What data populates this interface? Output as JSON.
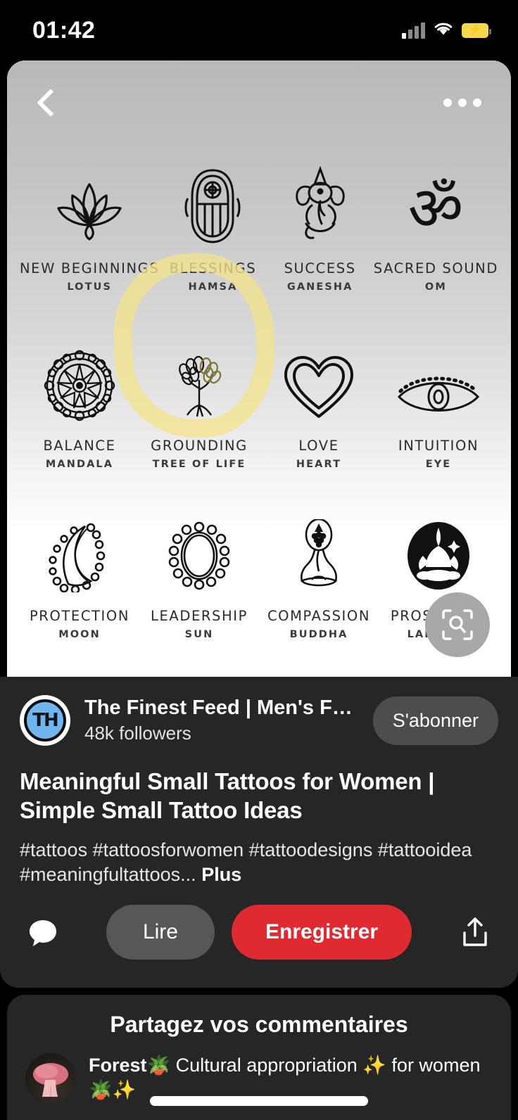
{
  "status_bar": {
    "time": "01:42",
    "signal_icon": "cellular-signal-icon",
    "wifi_icon": "wifi-icon",
    "battery_icon": "battery-charging-icon",
    "battery_color": "#f5d84b"
  },
  "pin_image": {
    "back_icon": "back-chevron-icon",
    "more_icon": "more-options-icon",
    "lens_icon": "visual-search-icon",
    "highlight_color": "#f3e28c",
    "symbols": [
      {
        "title": "NEW BEGINNINGS",
        "subtitle": "LOTUS",
        "art": "lotus"
      },
      {
        "title": "BLESSINGS",
        "subtitle": "HAMSA",
        "art": "hamsa"
      },
      {
        "title": "SUCCESS",
        "subtitle": "GANESHA",
        "art": "ganesha"
      },
      {
        "title": "SACRED SOUND",
        "subtitle": "OM",
        "art": "om"
      },
      {
        "title": "BALANCE",
        "subtitle": "MANDALA",
        "art": "mandala"
      },
      {
        "title": "GROUNDING",
        "subtitle": "TREE OF LIFE",
        "art": "tree"
      },
      {
        "title": "LOVE",
        "subtitle": "HEART",
        "art": "heart"
      },
      {
        "title": "INTUITION",
        "subtitle": "EYE",
        "art": "eye"
      },
      {
        "title": "PROTECTION",
        "subtitle": "MOON",
        "art": "moon"
      },
      {
        "title": "LEADERSHIP",
        "subtitle": "SUN",
        "art": "sun"
      },
      {
        "title": "COMPASSION",
        "subtitle": "BUDDHA",
        "art": "buddha"
      },
      {
        "title": "PROSPERITY",
        "subtitle": "LAKSHMI",
        "art": "lakshmi"
      }
    ]
  },
  "creator": {
    "avatar_monogram": "TH",
    "avatar_color": "#6fb5ef",
    "name": "The Finest Feed | Men's Fa...",
    "followers": "48k followers",
    "subscribe_label": "S'abonner"
  },
  "pin": {
    "title": "Meaningful Small Tattoos for Women | Simple Small Tattoo Ideas",
    "description": "#tattoos #tattoosforwomen #tattoodesigns #tattooidea #meaningfultattoos...",
    "more_label": "Plus",
    "comment_icon": "comment-bubble-icon",
    "share_icon": "share-icon",
    "read_label": "Lire",
    "save_label": "Enregistrer",
    "save_color": "#e02a31"
  },
  "comments": {
    "heading": "Partagez vos commentaires",
    "avatar_icon": "mushroom-avatar",
    "author": "Forest",
    "author_emoji": "🪴",
    "text": " Cultural appropriation ✨ for women🪴✨"
  }
}
